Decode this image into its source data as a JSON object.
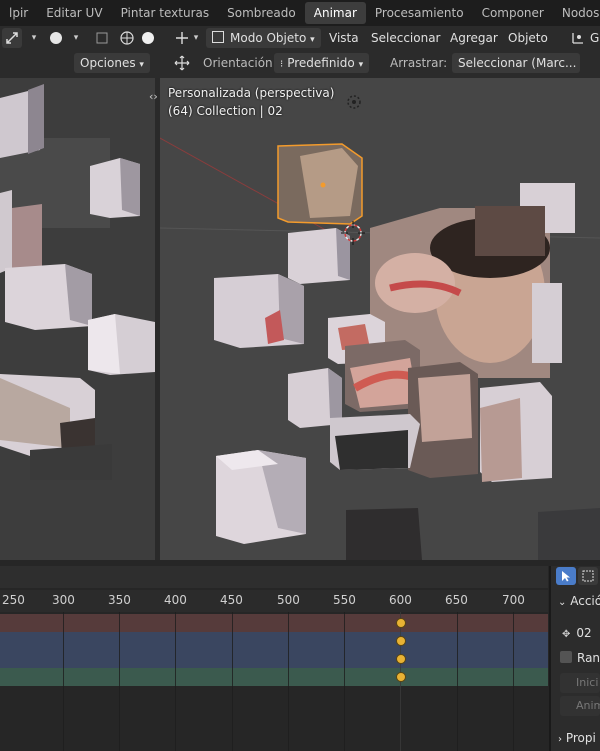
{
  "tabs": [
    {
      "label": "lpir"
    },
    {
      "label": "Editar UV"
    },
    {
      "label": "Pintar texturas"
    },
    {
      "label": "Sombreado"
    },
    {
      "label": "Animar",
      "active": true
    },
    {
      "label": "Procesamiento"
    },
    {
      "label": "Componer"
    },
    {
      "label": "Nodos de geo"
    }
  ],
  "header": {
    "mode_label": "Modo Objeto",
    "menu_view": "Vista",
    "menu_select": "Seleccionar",
    "menu_add": "Agregar",
    "menu_object": "Objeto",
    "right_letter": "G",
    "options_label": "Opciones",
    "orientation_label": "Orientación:",
    "orientation_value": "Predefinido",
    "drag_label": "Arrastrar:",
    "drag_value": "Seleccionar (Marc..."
  },
  "viewport": {
    "view_name": "Personalizada (perspectiva)",
    "collection_info": "(64) Collection | 02"
  },
  "timeline": {
    "ticks": [
      "250",
      "300",
      "350",
      "400",
      "450",
      "500",
      "550",
      "600",
      "650",
      "700"
    ],
    "current_frame": 600
  },
  "side_panel": {
    "section_label": "Acció",
    "action_name": "02",
    "range_label": "Rang",
    "start_label": "Inici",
    "anim_label": "Anim",
    "properties_label": "Propi"
  },
  "colors": {
    "accent": "#4a7cc9",
    "key": "#e8b234",
    "row_red": "#563b3b",
    "row_blue": "#3a4660",
    "row_green": "#3b5a4e"
  }
}
